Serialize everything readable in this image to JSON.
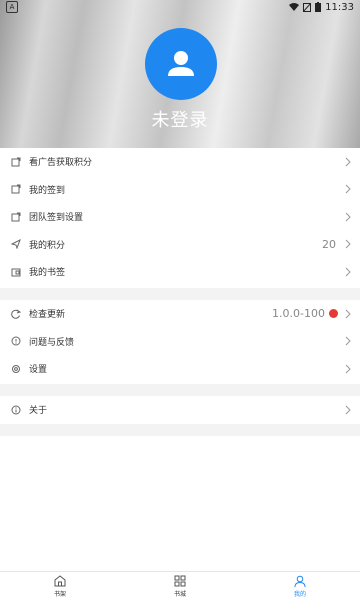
{
  "status_bar": {
    "time": "11:33",
    "left_badge": "A"
  },
  "profile": {
    "login_label": "未登录"
  },
  "menu_group_1": [
    {
      "label": "看广告获取积分",
      "icon": "ad-icon"
    },
    {
      "label": "我的签到",
      "icon": "checkin-icon"
    },
    {
      "label": "团队签到设置",
      "icon": "team-checkin-icon"
    },
    {
      "label": "我的积分",
      "icon": "send-icon",
      "value": "20"
    },
    {
      "label": "我的书签",
      "icon": "bookmark-icon"
    }
  ],
  "menu_group_2": [
    {
      "label": "检查更新",
      "icon": "refresh-icon",
      "value": "1.0.0-100",
      "badge_color": "#e53935"
    },
    {
      "label": "问题与反馈",
      "icon": "feedback-icon"
    },
    {
      "label": "设置",
      "icon": "settings-icon"
    }
  ],
  "menu_group_3": [
    {
      "label": "关于",
      "icon": "info-icon"
    }
  ],
  "bottom_nav": [
    {
      "label": "书架",
      "icon": "home-icon",
      "active": false
    },
    {
      "label": "书城",
      "icon": "grid-icon",
      "active": false
    },
    {
      "label": "我的",
      "icon": "user-icon",
      "active": true
    }
  ],
  "colors": {
    "accent": "#1e88f0",
    "badge": "#e53935",
    "gap": "#f3f3f3"
  }
}
